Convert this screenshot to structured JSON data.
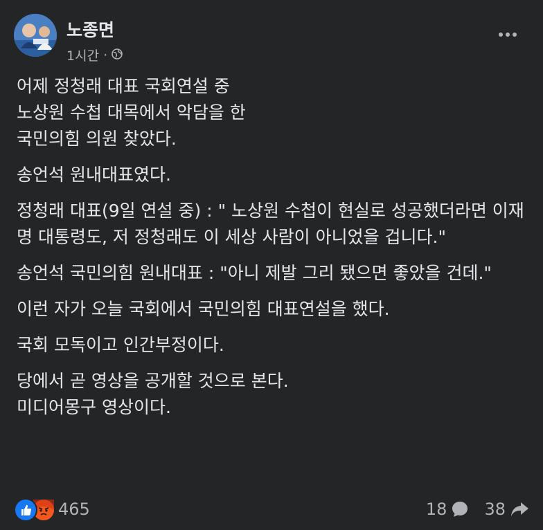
{
  "post": {
    "author": "노종면",
    "time": "1시간",
    "privacy_icon": "globe-icon",
    "more_icon": "more-options-icon",
    "paragraphs": [
      "어제 정청래 대표 국회연설 중\n노상원 수첩 대목에서 악담을 한\n국민의힘 의원 찾았다.",
      "송언석 원내대표였다.",
      "정청래 대표(9일 연설 중) : \" 노상원 수첩이 현실로 성공했더라면 이재명 대통령도, 저 정청래도 이 세상 사람이 아니었을 겁니다.\"",
      "송언석 국민의힘 원내대표 : \"아니 제발 그리 됐으면 좋았을 건데.\"",
      "이런 자가 오늘 국회에서 국민의힘 대표연설을 했다.",
      "국회 모독이고 인간부정이다.",
      "당에서 곧 영상을 공개할 것으로 본다.\n미디어몽구 영상이다."
    ]
  },
  "footer": {
    "reaction_count": "465",
    "reaction_icons": [
      "like-icon",
      "angry-icon"
    ],
    "comment_count": "18",
    "share_count": "38",
    "comment_icon": "comment-icon",
    "share_icon": "share-icon"
  },
  "colors": {
    "background": "#242526",
    "text": "#e4e6eb",
    "secondary_text": "#b0b3b8",
    "like_blue": "#1877f2",
    "angry_orange": "#e9710f"
  }
}
